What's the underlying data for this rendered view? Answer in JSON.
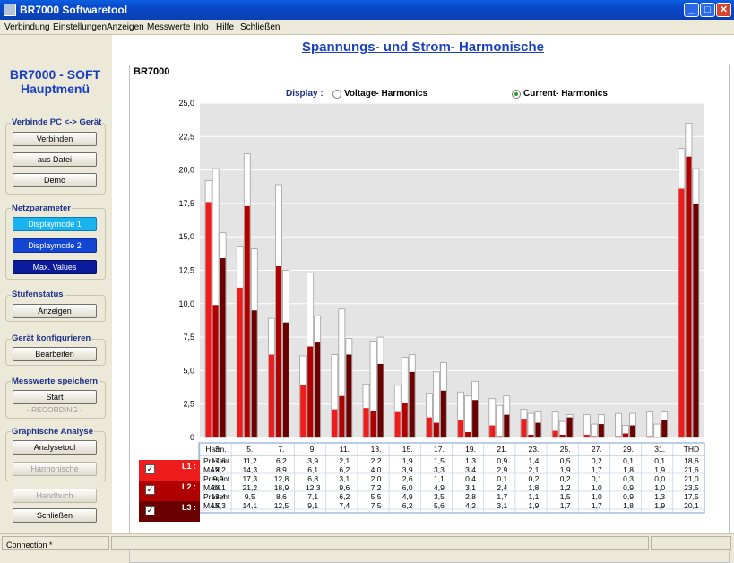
{
  "app": {
    "title": "BR7000 Softwaretool"
  },
  "menu": [
    "Verbindung",
    "Einstellungen",
    "Anzeigen",
    "Messwerte",
    "Info",
    "Hilfe",
    "Schließen"
  ],
  "sidebar": {
    "brand_line1": "BR7000 - SOFT",
    "brand_line2": "Hauptmenü",
    "groups": {
      "connect": {
        "label": "Verbinde PC <-> Gerät",
        "buttons": [
          "Verbinden",
          "aus Datei",
          "Demo"
        ]
      },
      "netz": {
        "label": "Netzparameter",
        "buttons": [
          "Displaymode 1",
          "Displaymode 2",
          "Max. Values"
        ]
      },
      "stufen": {
        "label": "Stufenstatus",
        "buttons": [
          "Anzeigen"
        ]
      },
      "config": {
        "label": "Gerät konfigurieren",
        "buttons": [
          "Bearbeiten"
        ]
      },
      "save": {
        "label": "Messwerte speichern",
        "buttons": [
          "Start"
        ],
        "recording": "- RECORDING -"
      },
      "analyse": {
        "label": "Graphische Analyse",
        "buttons": [
          "Analysetool",
          "Harmonische"
        ]
      }
    },
    "handbuch": "Handbuch",
    "close": "Schließen"
  },
  "main": {
    "heading": "Spannungs- und Strom- Harmonische",
    "panel_title": "BR7000",
    "display_label": "Display :",
    "radio_voltage": "Voltage- Harmonics",
    "radio_current": "Current- Harmonics",
    "selected": "current"
  },
  "colors": {
    "l1": "#ee1c1c",
    "l2": "#b00000",
    "l3": "#6a0000",
    "max_outline": "#a0a0a0"
  },
  "chart_data": {
    "type": "bar",
    "ylim": [
      0,
      25
    ],
    "yticks": [
      "0",
      "2,5",
      "5,0",
      "7,5",
      "10,0",
      "12,5",
      "15,0",
      "17,5",
      "20,0",
      "22,5",
      "25,0"
    ],
    "categories": [
      "3.",
      "5.",
      "7.",
      "9.",
      "11.",
      "13.",
      "15.",
      "17.",
      "19.",
      "21.",
      "23.",
      "25.",
      "27.",
      "29.",
      "31.",
      "THD"
    ],
    "table_header": "Harm.",
    "row_labels": [
      "Present",
      "MAX"
    ],
    "series": [
      {
        "name": "L1 :",
        "present": [
          17.6,
          11.2,
          6.2,
          3.9,
          2.1,
          2.2,
          1.9,
          1.5,
          1.3,
          0.9,
          1.4,
          0.5,
          0.2,
          0.1,
          0.1,
          18.6
        ],
        "max": [
          19.2,
          14.3,
          8.9,
          6.1,
          6.2,
          4.0,
          3.9,
          3.3,
          3.4,
          2.9,
          2.1,
          1.9,
          1.7,
          1.8,
          1.9,
          21.6
        ],
        "present_text": [
          "17,6",
          "11,2",
          "6,2",
          "3,9",
          "2,1",
          "2,2",
          "1,9",
          "1,5",
          "1,3",
          "0,9",
          "1,4",
          "0,5",
          "0,2",
          "0,1",
          "0,1",
          "18,6"
        ],
        "max_text": [
          "19,2",
          "14,3",
          "8,9",
          "6,1",
          "6,2",
          "4,0",
          "3,9",
          "3,3",
          "3,4",
          "2,9",
          "2,1",
          "1,9",
          "1,7",
          "1,8",
          "1,9",
          "21,6"
        ]
      },
      {
        "name": "L2 :",
        "present": [
          9.9,
          17.3,
          12.8,
          6.8,
          3.1,
          2.0,
          2.6,
          1.1,
          0.4,
          0.1,
          0.2,
          0.2,
          0.1,
          0.3,
          0.0,
          21.0
        ],
        "max": [
          20.1,
          21.2,
          18.9,
          12.3,
          9.6,
          7.2,
          6.0,
          4.9,
          3.1,
          2.4,
          1.8,
          1.2,
          1.0,
          0.9,
          1.0,
          23.5
        ],
        "present_text": [
          "9,9",
          "17,3",
          "12,8",
          "6,8",
          "3,1",
          "2,0",
          "2,6",
          "1,1",
          "0,4",
          "0,1",
          "0,2",
          "0,2",
          "0,1",
          "0,3",
          "0,0",
          "21,0"
        ],
        "max_text": [
          "20,1",
          "21,2",
          "18,9",
          "12,3",
          "9,6",
          "7,2",
          "6,0",
          "4,9",
          "3,1",
          "2,4",
          "1,8",
          "1,2",
          "1,0",
          "0,9",
          "1,0",
          "23,5"
        ]
      },
      {
        "name": "L3 :",
        "present": [
          13.4,
          9.5,
          8.6,
          7.1,
          6.2,
          5.5,
          4.9,
          3.5,
          2.8,
          1.7,
          1.1,
          1.5,
          1.0,
          0.9,
          1.3,
          17.5
        ],
        "max": [
          15.3,
          14.1,
          12.5,
          9.1,
          7.4,
          7.5,
          6.2,
          5.6,
          4.2,
          3.1,
          1.9,
          1.7,
          1.7,
          1.8,
          1.9,
          20.1
        ],
        "present_text": [
          "13,4",
          "9,5",
          "8,6",
          "7,1",
          "6,2",
          "5,5",
          "4,9",
          "3,5",
          "2,8",
          "1,7",
          "1,1",
          "1,5",
          "1,0",
          "0,9",
          "1,3",
          "17,5"
        ],
        "max_text": [
          "15,3",
          "14,1",
          "12,5",
          "9,1",
          "7,4",
          "7,5",
          "6,2",
          "5,6",
          "4,2",
          "3,1",
          "1,9",
          "1,7",
          "1,7",
          "1,8",
          "1,9",
          "20,1"
        ]
      }
    ]
  },
  "status": {
    "connection": "Connection  *"
  }
}
